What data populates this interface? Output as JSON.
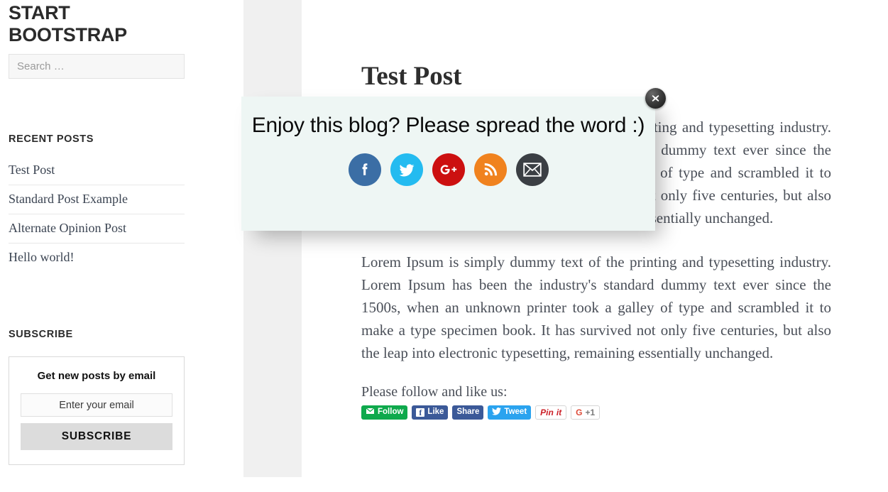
{
  "sidebar": {
    "brand_line1": "START",
    "brand_line2": "BOOTSTRAP",
    "search": {
      "placeholder": "Search …",
      "value": ""
    },
    "recent_posts": {
      "title": "RECENT POSTS",
      "items": [
        {
          "label": "Test Post"
        },
        {
          "label": "Standard Post Example"
        },
        {
          "label": "Alternate Opinion Post"
        },
        {
          "label": "Hello world!"
        }
      ]
    },
    "subscribe": {
      "title": "SUBSCRIBE",
      "heading": "Get new posts by email",
      "email_placeholder": "Enter your email",
      "email_value": "",
      "button_label": "SUBSCRIBE"
    }
  },
  "post": {
    "title": "Test Post",
    "paragraph_1": "Lorem Ipsum is simply dummy text of the printing and typesetting industry. Lorem Ipsum has been the industry's standard dummy text ever since the 1500s, when an unknown printer took a galley of type and scrambled it to make a type specimen book. It has survived not only five centuries, but also the leap into electronic typesetting, remaining essentially unchanged.",
    "paragraph_2": "Lorem Ipsum is simply dummy text of the printing and typesetting industry. Lorem Ipsum has been the industry's standard dummy text ever since the 1500s, when an unknown printer took a galley of type and scrambled it to make a type specimen book. It has survived not only five centuries, but also the leap into electronic typesetting, remaining essentially unchanged.",
    "follow_label": "Please follow and like us:",
    "share_buttons": [
      {
        "id": "follow",
        "label": "Follow",
        "icon": "envelope-icon",
        "color": "#0ea94c"
      },
      {
        "id": "facebook-like",
        "label": "Like",
        "icon": "facebook-icon",
        "color": "#3b5998"
      },
      {
        "id": "facebook-share",
        "label": "Share",
        "icon": "",
        "color": "#3b5998"
      },
      {
        "id": "twitter-tweet",
        "label": "Tweet",
        "icon": "twitter-icon",
        "color": "#2aa3ef"
      },
      {
        "id": "pinterest",
        "label": "Pin it",
        "icon": "pinterest-icon",
        "color": "#cb2027"
      },
      {
        "id": "google-plus-one",
        "label": "+1",
        "prefix": "G",
        "icon": "google-plus-icon",
        "color": "#dd4b39"
      }
    ]
  },
  "modal": {
    "heading": "Enjoy this blog? Please spread the word :)",
    "background_color": "#eef6f4",
    "close_label": "×",
    "icons": [
      {
        "name": "facebook-icon",
        "color": "#3b6ea5",
        "title": "Facebook"
      },
      {
        "name": "twitter-icon",
        "color": "#24bbf0",
        "title": "Twitter"
      },
      {
        "name": "google-plus-icon",
        "color": "#cc1010",
        "title": "Google Plus"
      },
      {
        "name": "rss-icon",
        "color": "#f0821e",
        "title": "RSS"
      },
      {
        "name": "email-icon",
        "color": "#3b3f44",
        "title": "Email"
      }
    ]
  }
}
